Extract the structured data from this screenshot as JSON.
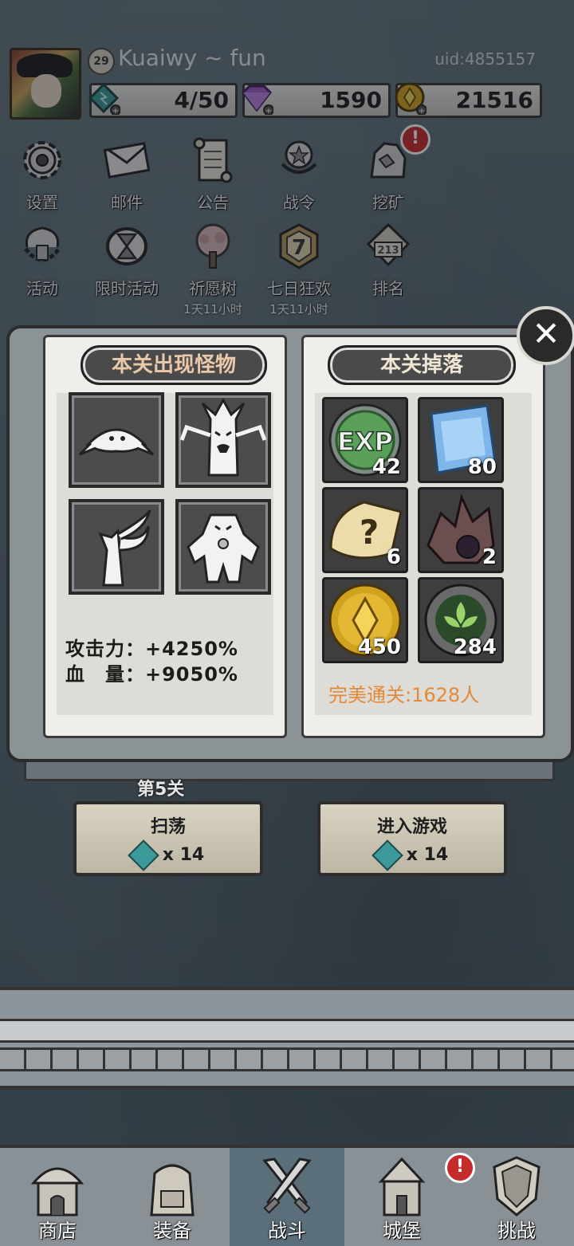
{
  "player": {
    "level": "29",
    "username": "Kuaiwy ~ fun",
    "uid": "uid:4855157"
  },
  "resources": [
    {
      "icon": "energy-gem-icon",
      "value": "4/50",
      "color": "#3d9a9a"
    },
    {
      "icon": "purple-diamond-icon",
      "value": "1590",
      "color": "#9b5cc4"
    },
    {
      "icon": "gold-coin-icon",
      "value": "21516",
      "color": "#d1a21f"
    }
  ],
  "menu": [
    {
      "label": "设置",
      "icon": "gear-icon"
    },
    {
      "label": "邮件",
      "icon": "envelope-icon"
    },
    {
      "label": "公告",
      "icon": "scroll-icon"
    },
    {
      "label": "战令",
      "icon": "medal-icon"
    },
    {
      "label": "挖矿",
      "icon": "ore-icon",
      "alert": "!"
    },
    {
      "label": "活动",
      "icon": "trophy-icon"
    },
    {
      "label": "限时活动",
      "icon": "hourglass-icon"
    },
    {
      "label": "祈愿树",
      "icon": "tree-icon",
      "sub": "1天11小时"
    },
    {
      "label": "七日狂欢",
      "icon": "seven-badge-icon",
      "badge_text": "7",
      "sub": "1天11小时"
    },
    {
      "label": "排名",
      "icon": "podium-icon",
      "podium_text": "213"
    }
  ],
  "book": {
    "left_title": "本关出现怪物",
    "right_title": "本关掉落",
    "monsters": [
      "slime-monster-icon",
      "tree-monster-icon",
      "fox-monster-icon",
      "golem-monster-icon"
    ],
    "stats": [
      {
        "label": "攻击力：",
        "value": "+4250%"
      },
      {
        "label": "血　量：",
        "value": "+9050%"
      }
    ],
    "drops": [
      {
        "icon": "exp-orb-icon",
        "icon_text": "EXP",
        "count": "42"
      },
      {
        "icon": "blue-crystal-icon",
        "count": "80"
      },
      {
        "icon": "mystery-scroll-icon",
        "icon_text": "?",
        "count": "6"
      },
      {
        "icon": "dark-ore-icon",
        "count": "2"
      },
      {
        "icon": "gold-coin-icon",
        "count": "450"
      },
      {
        "icon": "green-emblem-icon",
        "count": "284"
      }
    ],
    "perfect_clear": "完美通关:1628人"
  },
  "stage": {
    "label": "第5关",
    "buttons": [
      {
        "title": "扫荡",
        "cost_mult": "x",
        "cost": "14"
      },
      {
        "title": "进入游戏",
        "cost_mult": "x",
        "cost": "14"
      }
    ]
  },
  "nav": [
    {
      "label": "商店",
      "icon": "shop-hut-icon"
    },
    {
      "label": "装备",
      "icon": "backpack-icon"
    },
    {
      "label": "战斗",
      "icon": "crossed-swords-icon",
      "active": true
    },
    {
      "label": "城堡",
      "icon": "castle-icon",
      "alert": "!"
    },
    {
      "label": "挑战",
      "icon": "shield-icon"
    }
  ]
}
